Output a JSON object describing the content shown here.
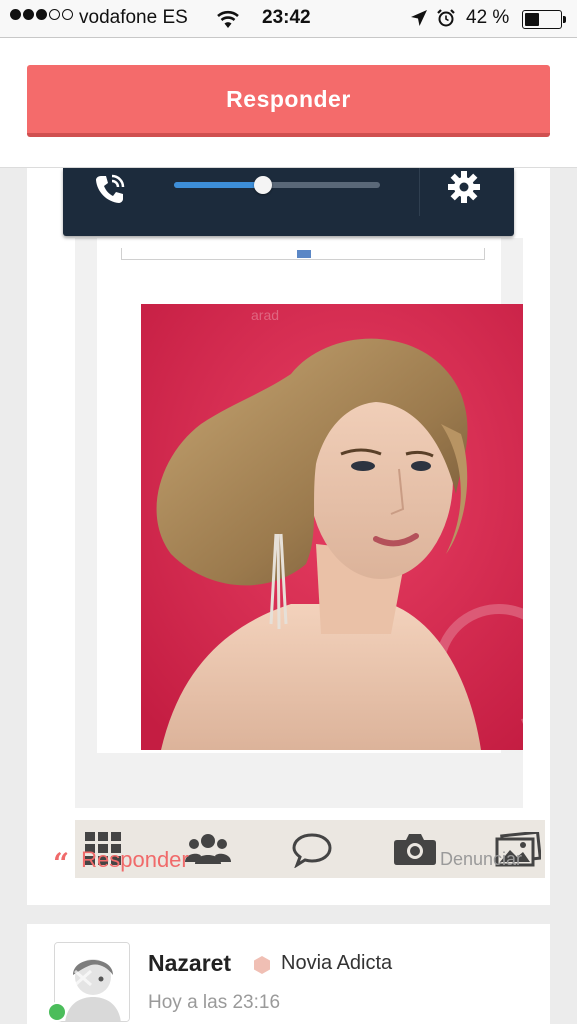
{
  "status_bar": {
    "signal_dots": [
      true,
      true,
      true,
      false,
      false
    ],
    "carrier": "vodafone ES",
    "time": "23:42",
    "battery_percent": "42 %",
    "battery_level": 0.42,
    "icons": [
      "wifi-icon",
      "location-arrow-icon",
      "alarm-clock-icon",
      "battery-icon"
    ]
  },
  "header": {
    "reply_button_label": "Responder",
    "accent_color": "#f46b6b"
  },
  "media_player": {
    "icons": [
      "phone-volume-icon",
      "gear-icon"
    ],
    "volume_level": 0.43,
    "background_color": "#1c2b3c",
    "fill_color": "#3d8ed8"
  },
  "embed": {
    "photo_icon": "portrait-photo",
    "toolbar_icons": [
      "grid-icon",
      "group-icon",
      "speech-bubble-icon",
      "camera-icon",
      "gallery-icon"
    ]
  },
  "post_actions": {
    "reply_label": "Responder",
    "reply_icon": "quote-icon",
    "report_label": "Denunciar"
  },
  "next_post": {
    "author": "Nazaret",
    "rank": "Novia Adicta",
    "time": "Hoy a las 23:16",
    "online_color": "#4bbd5b",
    "badge_color": "#f0bfb4"
  }
}
